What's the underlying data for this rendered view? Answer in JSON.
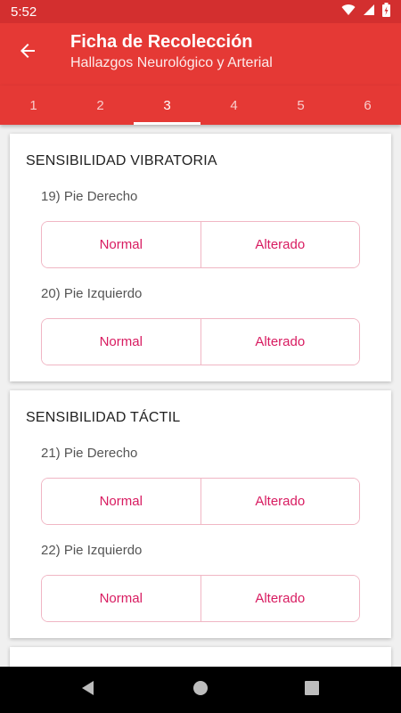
{
  "status_bar": {
    "time": "5:52"
  },
  "header": {
    "title": "Ficha de Recolección",
    "subtitle": "Hallazgos Neurológico y Arterial"
  },
  "tabs": [
    {
      "label": "1"
    },
    {
      "label": "2"
    },
    {
      "label": "3",
      "active": true
    },
    {
      "label": "4"
    },
    {
      "label": "5"
    },
    {
      "label": "6"
    }
  ],
  "sections": [
    {
      "title": "SENSIBILIDAD VIBRATORIA",
      "questions": [
        {
          "label": "19) Pie Derecho",
          "options": [
            "Normal",
            "Alterado"
          ]
        },
        {
          "label": "20) Pie Izquierdo",
          "options": [
            "Normal",
            "Alterado"
          ]
        }
      ]
    },
    {
      "title": "SENSIBILIDAD TÁCTIL",
      "questions": [
        {
          "label": "21) Pie Derecho",
          "options": [
            "Normal",
            "Alterado"
          ]
        },
        {
          "label": "22) Pie Izquierdo",
          "options": [
            "Normal",
            "Alterado"
          ]
        }
      ]
    }
  ],
  "colors": {
    "primary": "#e53935",
    "primary_dark": "#d32f2f",
    "accent": "#d81b60",
    "toggle_border": "#f0b6c4"
  },
  "icons": {
    "back": "arrow-back-icon",
    "wifi": "wifi-icon",
    "signal": "cellular-signal-icon",
    "battery": "battery-charging-icon",
    "nav_back": "nav-back-icon",
    "nav_home": "nav-home-icon",
    "nav_recents": "nav-recents-icon"
  }
}
